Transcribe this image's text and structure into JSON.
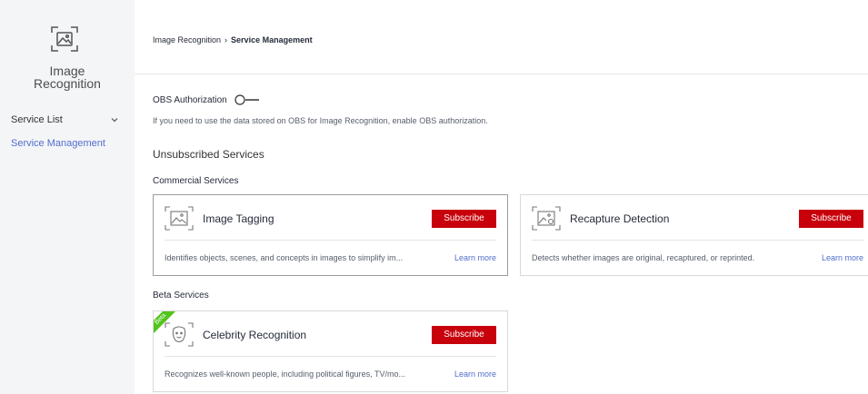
{
  "sidebar": {
    "brand_line1": "Image",
    "brand_line2": "Recognition",
    "items": [
      {
        "label": "Service List"
      },
      {
        "label": "Service Management"
      }
    ]
  },
  "header": {
    "breadcrumb_root": "Image Recognition",
    "breadcrumb_separator": "›",
    "breadcrumb_current": "Service Management"
  },
  "obs": {
    "label": "OBS Authorization",
    "description": "If you need to use the data stored on OBS for Image Recognition, enable OBS authorization.",
    "enabled": false
  },
  "sections": {
    "unsubscribed_title": "Unsubscribed Services",
    "commercial_title": "Commercial Services",
    "beta_title": "Beta Services"
  },
  "cards": {
    "image_tagging": {
      "title": "Image Tagging",
      "button": "Subscribe",
      "description": "Identifies objects, scenes, and concepts in images to simplify im...",
      "link": "Learn more"
    },
    "recapture": {
      "title": "Recapture Detection",
      "button": "Subscribe",
      "description": "Detects whether images are original, recaptured, or reprinted.",
      "link": "Learn more"
    },
    "celebrity": {
      "badge": "Beta",
      "title": "Celebrity Recognition",
      "button": "Subscribe",
      "description": "Recognizes well-known people, including political figures, TV/mo...",
      "link": "Learn more"
    }
  },
  "colors": {
    "brand_red": "#c7000b",
    "link_blue": "#526ecc",
    "beta_green": "#52c41a",
    "sidebar_bg": "#f4f5f7"
  }
}
